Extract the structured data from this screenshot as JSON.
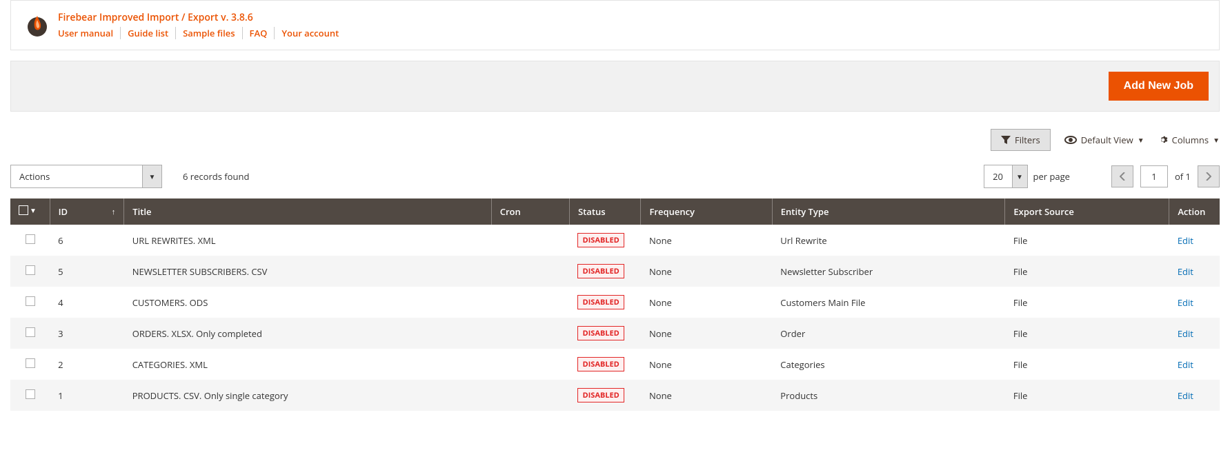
{
  "header": {
    "title": "Firebear Improved Import / Export v. 3.8.6",
    "links": [
      {
        "label": "User manual"
      },
      {
        "label": "Guide list"
      },
      {
        "label": "Sample files"
      },
      {
        "label": "FAQ"
      },
      {
        "label": "Your account"
      }
    ]
  },
  "primary_button": "Add New Job",
  "toolbar": {
    "filters": "Filters",
    "default_view": "Default View",
    "columns": "Columns"
  },
  "controls": {
    "actions_label": "Actions",
    "records_found": "6 records found",
    "page_size": "20",
    "per_page": "per page",
    "page_current": "1",
    "page_total": "of 1"
  },
  "columns": {
    "id": "ID",
    "title": "Title",
    "cron": "Cron",
    "status": "Status",
    "frequency": "Frequency",
    "entity_type": "Entity Type",
    "export_source": "Export Source",
    "action": "Action"
  },
  "rows": [
    {
      "id": "6",
      "title": "URL REWRITES. XML",
      "cron": "",
      "status": "DISABLED",
      "frequency": "None",
      "entity_type": "Url Rewrite",
      "export_source": "File",
      "action": "Edit"
    },
    {
      "id": "5",
      "title": "NEWSLETTER SUBSCRIBERS. CSV",
      "cron": "",
      "status": "DISABLED",
      "frequency": "None",
      "entity_type": "Newsletter Subscriber",
      "export_source": "File",
      "action": "Edit"
    },
    {
      "id": "4",
      "title": "CUSTOMERS. ODS",
      "cron": "",
      "status": "DISABLED",
      "frequency": "None",
      "entity_type": "Customers Main File",
      "export_source": "File",
      "action": "Edit"
    },
    {
      "id": "3",
      "title": "ORDERS. XLSX. Only completed",
      "cron": "",
      "status": "DISABLED",
      "frequency": "None",
      "entity_type": "Order",
      "export_source": "File",
      "action": "Edit"
    },
    {
      "id": "2",
      "title": "CATEGORIES. XML",
      "cron": "",
      "status": "DISABLED",
      "frequency": "None",
      "entity_type": "Categories",
      "export_source": "File",
      "action": "Edit"
    },
    {
      "id": "1",
      "title": "PRODUCTS. CSV. Only single category",
      "cron": "",
      "status": "DISABLED",
      "frequency": "None",
      "entity_type": "Products",
      "export_source": "File",
      "action": "Edit"
    }
  ]
}
